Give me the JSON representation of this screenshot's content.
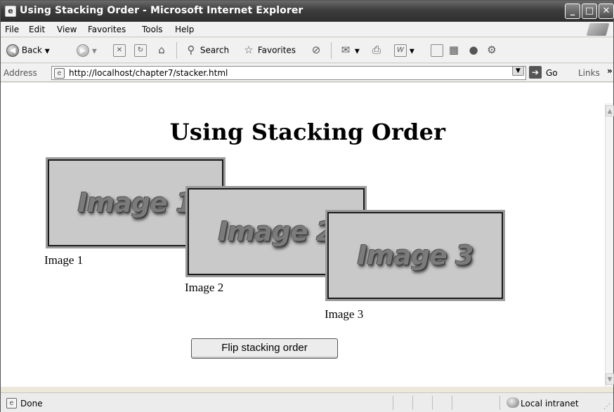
{
  "window": {
    "title": "Using Stacking Order - Microsoft Internet Explorer",
    "min_glyph": "_",
    "max_glyph": "□",
    "close_glyph": "✕"
  },
  "menu": {
    "items": [
      "File",
      "Edit",
      "View",
      "Favorites",
      "Tools",
      "Help"
    ]
  },
  "toolbar": {
    "back_label": "Back",
    "search_label": "Search",
    "favorites_label": "Favorites"
  },
  "address": {
    "label": "Address",
    "url": "http://localhost/chapter7/stacker.html",
    "go_label": "Go",
    "links_label": "Links",
    "links_chevron": "»"
  },
  "page": {
    "heading": "Using Stacking Order",
    "images": [
      {
        "text": "Image 1",
        "caption": "Image 1"
      },
      {
        "text": "Image 2",
        "caption": "Image 2"
      },
      {
        "text": "Image 3",
        "caption": "Image 3"
      }
    ],
    "flip_button_label": "Flip stacking order"
  },
  "status": {
    "text": "Done",
    "zone": "Local intranet"
  }
}
